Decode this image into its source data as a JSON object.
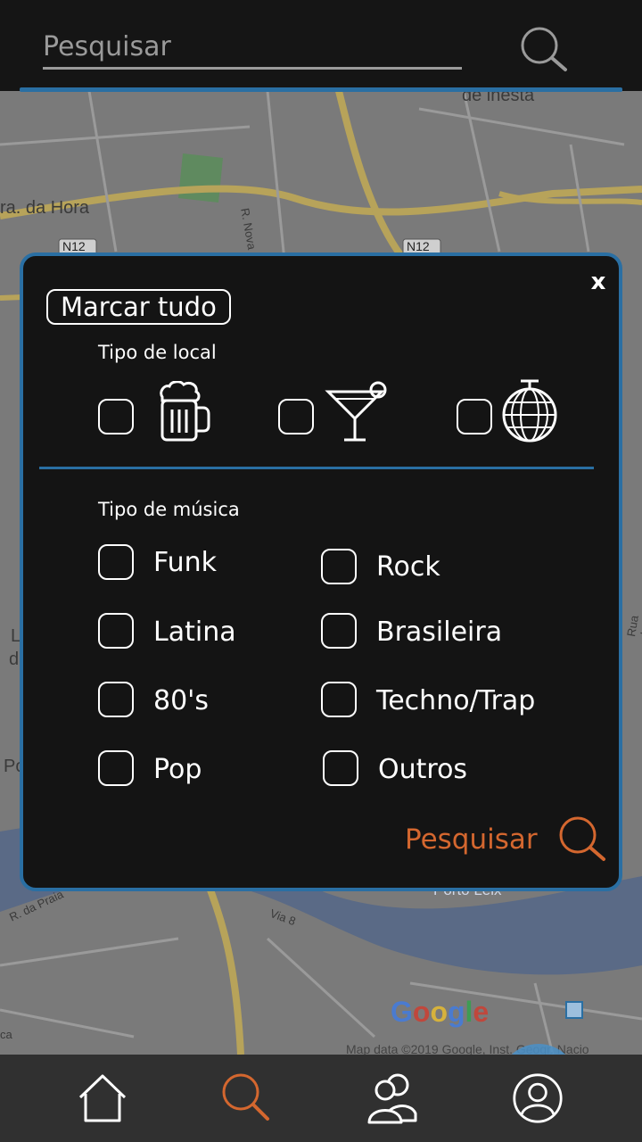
{
  "top_search": {
    "placeholder": "Pesquisar",
    "icon": "search-icon"
  },
  "map": {
    "labels": [
      "de inesta",
      "ra. da Hora",
      "R. Nova do Seixo",
      "N12",
      "N12",
      "L",
      "d",
      "Po",
      "Rua da Mar",
      "R. da Praia",
      "Via 8",
      "ca",
      "Porto Leix"
    ],
    "google_logo": "Google",
    "attribution": "Map data ©2019 Google, Inst. Geogr. Nacio",
    "fab_icon": "more-vertical-icon"
  },
  "dialog": {
    "close_label": "x",
    "mark_all_label": "Marcar tudo",
    "venue_section_label": "Tipo de local",
    "venue_types": [
      {
        "icon": "beer-mug-icon",
        "checked": false
      },
      {
        "icon": "cocktail-icon",
        "checked": false
      },
      {
        "icon": "disco-ball-icon",
        "checked": false
      }
    ],
    "music_section_label": "Tipo de música",
    "music_types": [
      {
        "label": "Funk",
        "checked": false
      },
      {
        "label": "Rock",
        "checked": false
      },
      {
        "label": "Latina",
        "checked": false
      },
      {
        "label": "Brasileira",
        "checked": false
      },
      {
        "label": "80's",
        "checked": false
      },
      {
        "label": "Techno/Trap",
        "checked": false
      },
      {
        "label": "Pop",
        "checked": false
      },
      {
        "label": "Outros",
        "checked": false
      }
    ],
    "search_label": "Pesquisar"
  },
  "colors": {
    "accent_blue": "#2a6fa3",
    "accent_orange": "#d4672f",
    "panel_bg": "#141414"
  },
  "bottom_nav": [
    {
      "icon": "home-icon",
      "active": false
    },
    {
      "icon": "search-icon",
      "active": true
    },
    {
      "icon": "group-icon",
      "active": false
    },
    {
      "icon": "profile-icon",
      "active": false
    }
  ]
}
